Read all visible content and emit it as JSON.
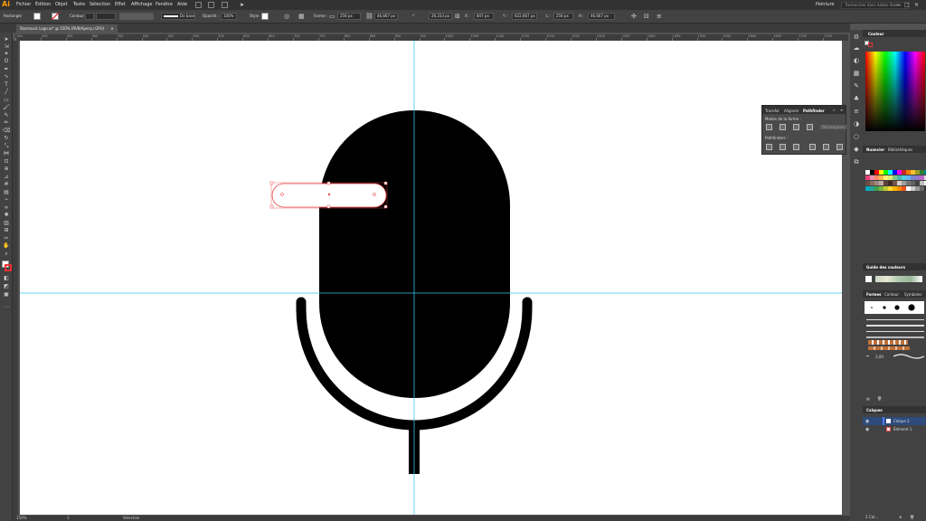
{
  "app": {
    "logo": "Ai",
    "menu": [
      "Fichier",
      "Édition",
      "Objet",
      "Texte",
      "Sélection",
      "Effet",
      "Affichage",
      "Fenêtre",
      "Aide"
    ],
    "workspace": "Peinture",
    "search_placeholder": "Rechercher dans Adobe Stock"
  },
  "control_bar": {
    "object_type": "Rectangle",
    "stroke_label": "Contour :",
    "stroke_value": "",
    "brush_label": "De base",
    "opacity_label": "Opacité :",
    "opacity_value": "100%",
    "style_label": "Style :",
    "shape_label": "Forme :",
    "shape_w": "256 px",
    "shape_h": "46,667 px",
    "angle": "26,333 px",
    "x_value": "847 px",
    "y_value": "622,667 px",
    "w_value": "256 px",
    "h_value": "46,667 px"
  },
  "document": {
    "tab_title": "Starmusic Logo.ai* @ 150% (RVB/Aperçu GPU)",
    "ruler_labels": [
      "150",
      "200",
      "250",
      "300",
      "350",
      "400",
      "450",
      "500",
      "550",
      "600",
      "650",
      "700",
      "750",
      "800",
      "850",
      "900",
      "950",
      "1000",
      "1050",
      "1100",
      "1150",
      "1200",
      "1250",
      "1300",
      "1350",
      "1400",
      "1450",
      "1500",
      "1550",
      "1600",
      "1650",
      "1700",
      "1750"
    ]
  },
  "status_bar": {
    "zoom": "150%",
    "page": "1",
    "tool": "Sélection"
  },
  "panels": {
    "color_tab": "Couleur",
    "swatches_tabs": [
      "Nuancier",
      "Bibliothèques"
    ],
    "color_guide_tab": "Guide des couleurs",
    "brushes_tabs": [
      "Formes",
      "Contour",
      "Symboles"
    ],
    "brush_size": "3,00",
    "layers_tab": "Calques",
    "layers": [
      {
        "name": "Calque 2",
        "color": "#4f7cff"
      },
      {
        "name": "Élément 1",
        "color": "#ff4d4d"
      }
    ],
    "layers_footer": "2 Cal..."
  },
  "pathfinder": {
    "tabs": [
      "Transfor",
      "Alignem",
      "Pathfinder"
    ],
    "shape_modes_label": "Modes de la forme :",
    "pathfinders_label": "Pathfinders :",
    "expand_button": "Décomposer"
  },
  "colors": {
    "accent_orange": "#ff9a00",
    "guide_cyan": "#37c8f0",
    "selection_red": "#e84a4a"
  }
}
